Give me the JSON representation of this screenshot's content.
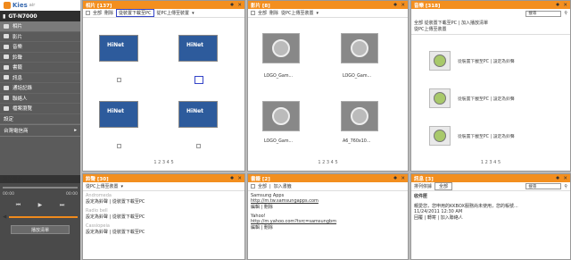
{
  "sidebar": {
    "logo": "Kies",
    "logo_sub": "air",
    "device": "GT-N7000",
    "items": [
      "相片",
      "影片",
      "音樂",
      "鈴聲",
      "書籤",
      "訊息",
      "通話記錄",
      "聯絡人",
      "檔案瀏覽",
      "設定"
    ],
    "store": "台灣電信商",
    "player": {
      "title": "現正播放",
      "t_start": "00:00",
      "t_end": "00:00",
      "playlist": "播放清單"
    }
  },
  "photos": {
    "title": "相片 [137]",
    "all": "全部",
    "delete": "刪除",
    "save_pc": "從裝置下載至PC",
    "to_device": "從PC上傳至裝置",
    "logo": "HiNet",
    "pager": "1 2 3 4 5"
  },
  "videos": {
    "title": "影片 [8]",
    "all": "全部",
    "delete": "刪除",
    "to_device": "從PC上傳至裝置",
    "labels": [
      "LOGO_Gam...",
      "LOGO_Gam...",
      "LOGO_Gam...",
      "A6_760x10..."
    ],
    "pager": "1 2 3 4 5"
  },
  "music": {
    "title": "音樂 [318]",
    "search": "搜尋",
    "all": "全部",
    "dl": "從裝置下載至PC",
    "sep": "|",
    "dl2": "加入播放清單",
    "up": "從PC上傳至裝置",
    "item_dl": "從裝置下載至PC",
    "item_set": "設定為鈴聲",
    "pager": "1 2 3 4 5"
  },
  "ringtones": {
    "title": "鈴聲 [30]",
    "to_device": "從PC上傳至裝置",
    "rows": [
      {
        "name": "Andromeda",
        "a": "設定為鈴聲",
        "b": "從裝置下載至PC"
      },
      {
        "name": "Radio bell",
        "a": "設定為鈴聲",
        "b": "從裝置下載至PC"
      },
      {
        "name": "Cassiopeia",
        "a": "設定為鈴聲",
        "b": "從裝置下載至PC"
      }
    ]
  },
  "bookmarks": {
    "title": "書籤 [2]",
    "all": "全部",
    "add": "加入書籤",
    "rows": [
      {
        "name": "Samsung Apps",
        "url": "http://m.tw.samsungapps.com",
        "e": "編輯",
        "d": "刪除"
      },
      {
        "name": "Yahoo!",
        "url": "http://m.yahoo.com?tsrc=samsungbm",
        "e": "編輯",
        "d": "刪除"
      }
    ]
  },
  "messages": {
    "title": "訊息 [3]",
    "sort": "排列依據",
    "sort_val": "全部",
    "search": "搜尋",
    "inbox": "收件匣",
    "msg": "親愛您，您申用的KKBOX服務尚未使用，您的帳號...",
    "date": "11/24/2011 12:30 AM",
    "reply": "回覆",
    "fwd": "轉寄",
    "add": "加入聯絡人"
  }
}
